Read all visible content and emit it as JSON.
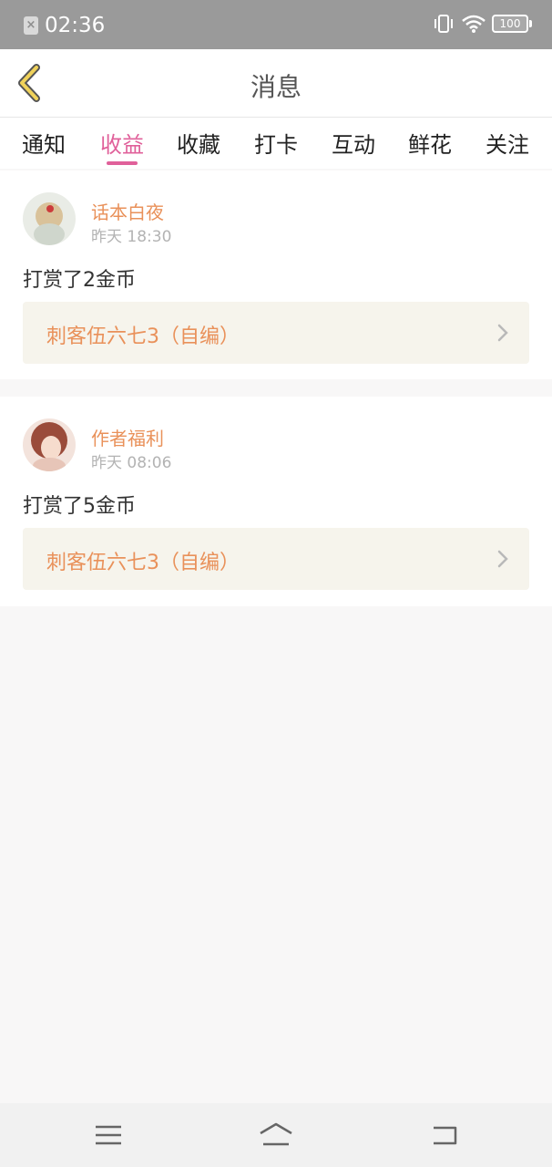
{
  "status_bar": {
    "time": "02:36",
    "battery": "100",
    "sim_icon": "sim-off-icon"
  },
  "header": {
    "title": "消息",
    "back_icon": "chevron-left-icon"
  },
  "tabs": [
    {
      "label": "通知"
    },
    {
      "label": "收益",
      "active": true
    },
    {
      "label": "收藏"
    },
    {
      "label": "打卡"
    },
    {
      "label": "互动"
    },
    {
      "label": "鲜花"
    },
    {
      "label": "关注"
    }
  ],
  "messages": [
    {
      "name": "话本白夜",
      "time": "昨天 18:30",
      "action": "打赏了2金币",
      "book": "刺客伍六七3（自编）"
    },
    {
      "name": "作者福利",
      "time": "昨天 08:06",
      "action": "打赏了5金币",
      "book": "刺客伍六七3（自编）"
    }
  ],
  "colors": {
    "accent": "#e0609a",
    "orange": "#e9915a",
    "back_icon": "#e8c84a"
  },
  "bottom_nav": [
    "menu-icon",
    "home-icon",
    "back-icon"
  ]
}
